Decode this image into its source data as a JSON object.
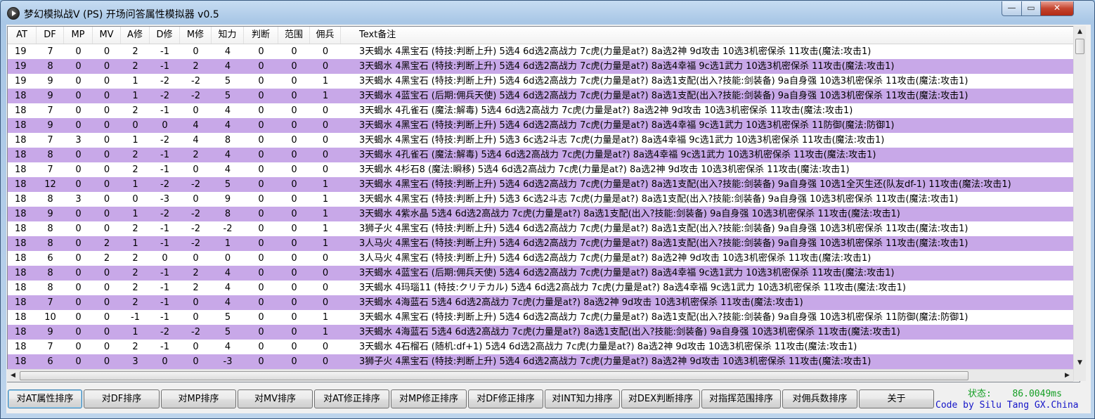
{
  "window": {
    "title": "梦幻模拟战V (PS) 开场问答属性模拟器 v0.5",
    "minimize": "—",
    "maximize": "▭",
    "close": "✕"
  },
  "columns": [
    "AT",
    "DF",
    "MP",
    "MV",
    "A修",
    "D修",
    "M修",
    "知力",
    "判断",
    "范围",
    "佣兵",
    "Text备注"
  ],
  "rows": [
    {
      "v": [
        "19",
        "7",
        "0",
        "0",
        "2",
        "-1",
        "0",
        "4",
        "0",
        "0",
        "0"
      ],
      "note": "3天蝎水 4黑宝石 (特技:判断上升) 5选4 6d选2高战力 7c虎(力量是at?) 8a选2神 9d攻击 10选3机密保杀 11攻击(魔法:攻击1)"
    },
    {
      "v": [
        "19",
        "8",
        "0",
        "0",
        "2",
        "-1",
        "2",
        "4",
        "0",
        "0",
        "0"
      ],
      "note": "3天蝎水 4黑宝石 (特技:判断上升) 5选4 6d选2高战力 7c虎(力量是at?) 8a选4幸福 9c选1武力 10选3机密保杀 11攻击(魔法:攻击1)"
    },
    {
      "v": [
        "19",
        "9",
        "0",
        "0",
        "1",
        "-2",
        "-2",
        "5",
        "0",
        "0",
        "1"
      ],
      "note": "3天蝎水 4黑宝石 (特技:判断上升) 5选4 6d选2高战力 7c虎(力量是at?) 8a选1支配(出入?技能:剑装备) 9a自身强 10选3机密保杀 11攻击(魔法:攻击1)"
    },
    {
      "v": [
        "18",
        "9",
        "0",
        "0",
        "1",
        "-2",
        "-2",
        "5",
        "0",
        "0",
        "1"
      ],
      "note": "3天蝎水 4蓝宝石 (后期:佣兵天使) 5选4 6d选2高战力 7c虎(力量是at?) 8a选1支配(出入?技能:剑装备) 9a自身强 10选3机密保杀 11攻击(魔法:攻击1)"
    },
    {
      "v": [
        "18",
        "7",
        "0",
        "0",
        "2",
        "-1",
        "0",
        "4",
        "0",
        "0",
        "0"
      ],
      "note": "3天蝎水 4孔雀石 (魔法:解毒) 5选4 6d选2高战力 7c虎(力量是at?) 8a选2神 9d攻击 10选3机密保杀 11攻击(魔法:攻击1)"
    },
    {
      "v": [
        "18",
        "9",
        "0",
        "0",
        "0",
        "0",
        "4",
        "4",
        "0",
        "0",
        "0"
      ],
      "note": "3天蝎水 4黑宝石 (特技:判断上升) 5选4 6d选2高战力 7c虎(力量是at?) 8a选4幸福 9c选1武力 10选3机密保杀 11防御(魔法:防御1)"
    },
    {
      "v": [
        "18",
        "7",
        "3",
        "0",
        "1",
        "-2",
        "4",
        "8",
        "0",
        "0",
        "0"
      ],
      "note": "3天蝎水 4黑宝石 (特技:判断上升) 5选3 6c选2斗志 7c虎(力量是at?) 8a选4幸福 9c选1武力 10选3机密保杀 11攻击(魔法:攻击1)"
    },
    {
      "v": [
        "18",
        "8",
        "0",
        "0",
        "2",
        "-1",
        "2",
        "4",
        "0",
        "0",
        "0"
      ],
      "note": "3天蝎水 4孔雀石 (魔法:解毒) 5选4 6d选2高战力 7c虎(力量是at?) 8a选4幸福 9c选1武力 10选3机密保杀 11攻击(魔法:攻击1)"
    },
    {
      "v": [
        "18",
        "7",
        "0",
        "0",
        "2",
        "-1",
        "0",
        "4",
        "0",
        "0",
        "0"
      ],
      "note": "3天蝎水 4杉石8 (魔法:瞬移) 5选4 6d选2高战力 7c虎(力量是at?) 8a选2神 9d攻击 10选3机密保杀 11攻击(魔法:攻击1)"
    },
    {
      "v": [
        "18",
        "12",
        "0",
        "0",
        "1",
        "-2",
        "-2",
        "5",
        "0",
        "0",
        "1"
      ],
      "note": "3天蝎水 4黑宝石 (特技:判断上升) 5选4 6d选2高战力 7c虎(力量是at?) 8a选1支配(出入?技能:剑装备) 9a自身强 10选1全灭生还(队友df-1) 11攻击(魔法:攻击1)"
    },
    {
      "v": [
        "18",
        "8",
        "3",
        "0",
        "0",
        "-3",
        "0",
        "9",
        "0",
        "0",
        "1"
      ],
      "note": "3天蝎水 4黑宝石 (特技:判断上升) 5选3 6c选2斗志 7c虎(力量是at?) 8a选1支配(出入?技能:剑装备) 9a自身强 10选3机密保杀 11攻击(魔法:攻击1)"
    },
    {
      "v": [
        "18",
        "9",
        "0",
        "0",
        "1",
        "-2",
        "-2",
        "8",
        "0",
        "0",
        "1"
      ],
      "note": "3天蝎水 4紫水晶 5选4 6d选2高战力 7c虎(力量是at?) 8a选1支配(出入?技能:剑装备) 9a自身强 10选3机密保杀 11攻击(魔法:攻击1)"
    },
    {
      "v": [
        "18",
        "8",
        "0",
        "0",
        "2",
        "-1",
        "-2",
        "-2",
        "0",
        "0",
        "1"
      ],
      "note": "3狮子火 4黑宝石 (特技:判断上升) 5选4 6d选2高战力 7c虎(力量是at?) 8a选1支配(出入?技能:剑装备) 9a自身强 10选3机密保杀 11攻击(魔法:攻击1)"
    },
    {
      "v": [
        "18",
        "8",
        "0",
        "2",
        "1",
        "-1",
        "-2",
        "1",
        "0",
        "0",
        "1"
      ],
      "note": "3人马火 4黑宝石 (特技:判断上升) 5选4 6d选2高战力 7c虎(力量是at?) 8a选1支配(出入?技能:剑装备) 9a自身强 10选3机密保杀 11攻击(魔法:攻击1)"
    },
    {
      "v": [
        "18",
        "6",
        "0",
        "2",
        "2",
        "0",
        "0",
        "0",
        "0",
        "0",
        "0"
      ],
      "note": "3人马火 4黑宝石 (特技:判断上升) 5选4 6d选2高战力 7c虎(力量是at?) 8a选2神 9d攻击 10选3机密保杀 11攻击(魔法:攻击1)"
    },
    {
      "v": [
        "18",
        "8",
        "0",
        "0",
        "2",
        "-1",
        "2",
        "4",
        "0",
        "0",
        "0"
      ],
      "note": "3天蝎水 4蓝宝石 (后期:佣兵天使) 5选4 6d选2高战力 7c虎(力量是at?) 8a选4幸福 9c选1武力 10选3机密保杀 11攻击(魔法:攻击1)"
    },
    {
      "v": [
        "18",
        "8",
        "0",
        "0",
        "2",
        "-1",
        "2",
        "4",
        "0",
        "0",
        "0"
      ],
      "note": "3天蝎水 4玛瑙11 (特技:クリテカル) 5选4 6d选2高战力 7c虎(力量是at?) 8a选4幸福 9c选1武力 10选3机密保杀 11攻击(魔法:攻击1)"
    },
    {
      "v": [
        "18",
        "7",
        "0",
        "0",
        "2",
        "-1",
        "0",
        "4",
        "0",
        "0",
        "0"
      ],
      "note": "3天蝎水 4海蓝石 5选4 6d选2高战力 7c虎(力量是at?) 8a选2神 9d攻击 10选3机密保杀 11攻击(魔法:攻击1)"
    },
    {
      "v": [
        "18",
        "10",
        "0",
        "0",
        "-1",
        "-1",
        "0",
        "5",
        "0",
        "0",
        "1"
      ],
      "note": "3天蝎水 4黑宝石 (特技:判断上升) 5选4 6d选2高战力 7c虎(力量是at?) 8a选1支配(出入?技能:剑装备) 9a自身强 10选3机密保杀 11防御(魔法:防御1)"
    },
    {
      "v": [
        "18",
        "9",
        "0",
        "0",
        "1",
        "-2",
        "-2",
        "5",
        "0",
        "0",
        "1"
      ],
      "note": "3天蝎水 4海蓝石 5选4 6d选2高战力 7c虎(力量是at?) 8a选1支配(出入?技能:剑装备) 9a自身强 10选3机密保杀 11攻击(魔法:攻击1)"
    },
    {
      "v": [
        "18",
        "7",
        "0",
        "0",
        "2",
        "-1",
        "0",
        "4",
        "0",
        "0",
        "0"
      ],
      "note": "3天蝎水 4石榴石 (随机:df+1) 5选4 6d选2高战力 7c虎(力量是at?) 8a选2神 9d攻击 10选3机密保杀 11攻击(魔法:攻击1)"
    },
    {
      "v": [
        "18",
        "6",
        "0",
        "0",
        "3",
        "0",
        "0",
        "-3",
        "0",
        "0",
        "0"
      ],
      "note": "3狮子火 4黑宝石 (特技:判断上升) 5选4 6d选2高战力 7c虎(力量是at?) 8a选2神 9d攻击 10选3机密保杀 11攻击(魔法:攻击1)"
    }
  ],
  "buttons": [
    "对AT属性排序",
    "对DF排序",
    "对MP排序",
    "对MV排序",
    "对AT修正排序",
    "对MP修正排序",
    "对DF修正排序",
    "对INT知力排序",
    "对DEX判断排序",
    "对指挥范围排序",
    "对佣兵数排序",
    "关于"
  ],
  "status": {
    "label": "状态:",
    "value": "86.0049ms"
  },
  "credit": "Code by Silu Tang  GX.China",
  "colors": {
    "alt_row": "#c8a8e8",
    "status_text": "#139e22",
    "credit_text": "#1414c8"
  },
  "icons": {
    "scroll_up": "▲",
    "scroll_down": "▼",
    "scroll_left": "◀",
    "scroll_right": "▶"
  }
}
